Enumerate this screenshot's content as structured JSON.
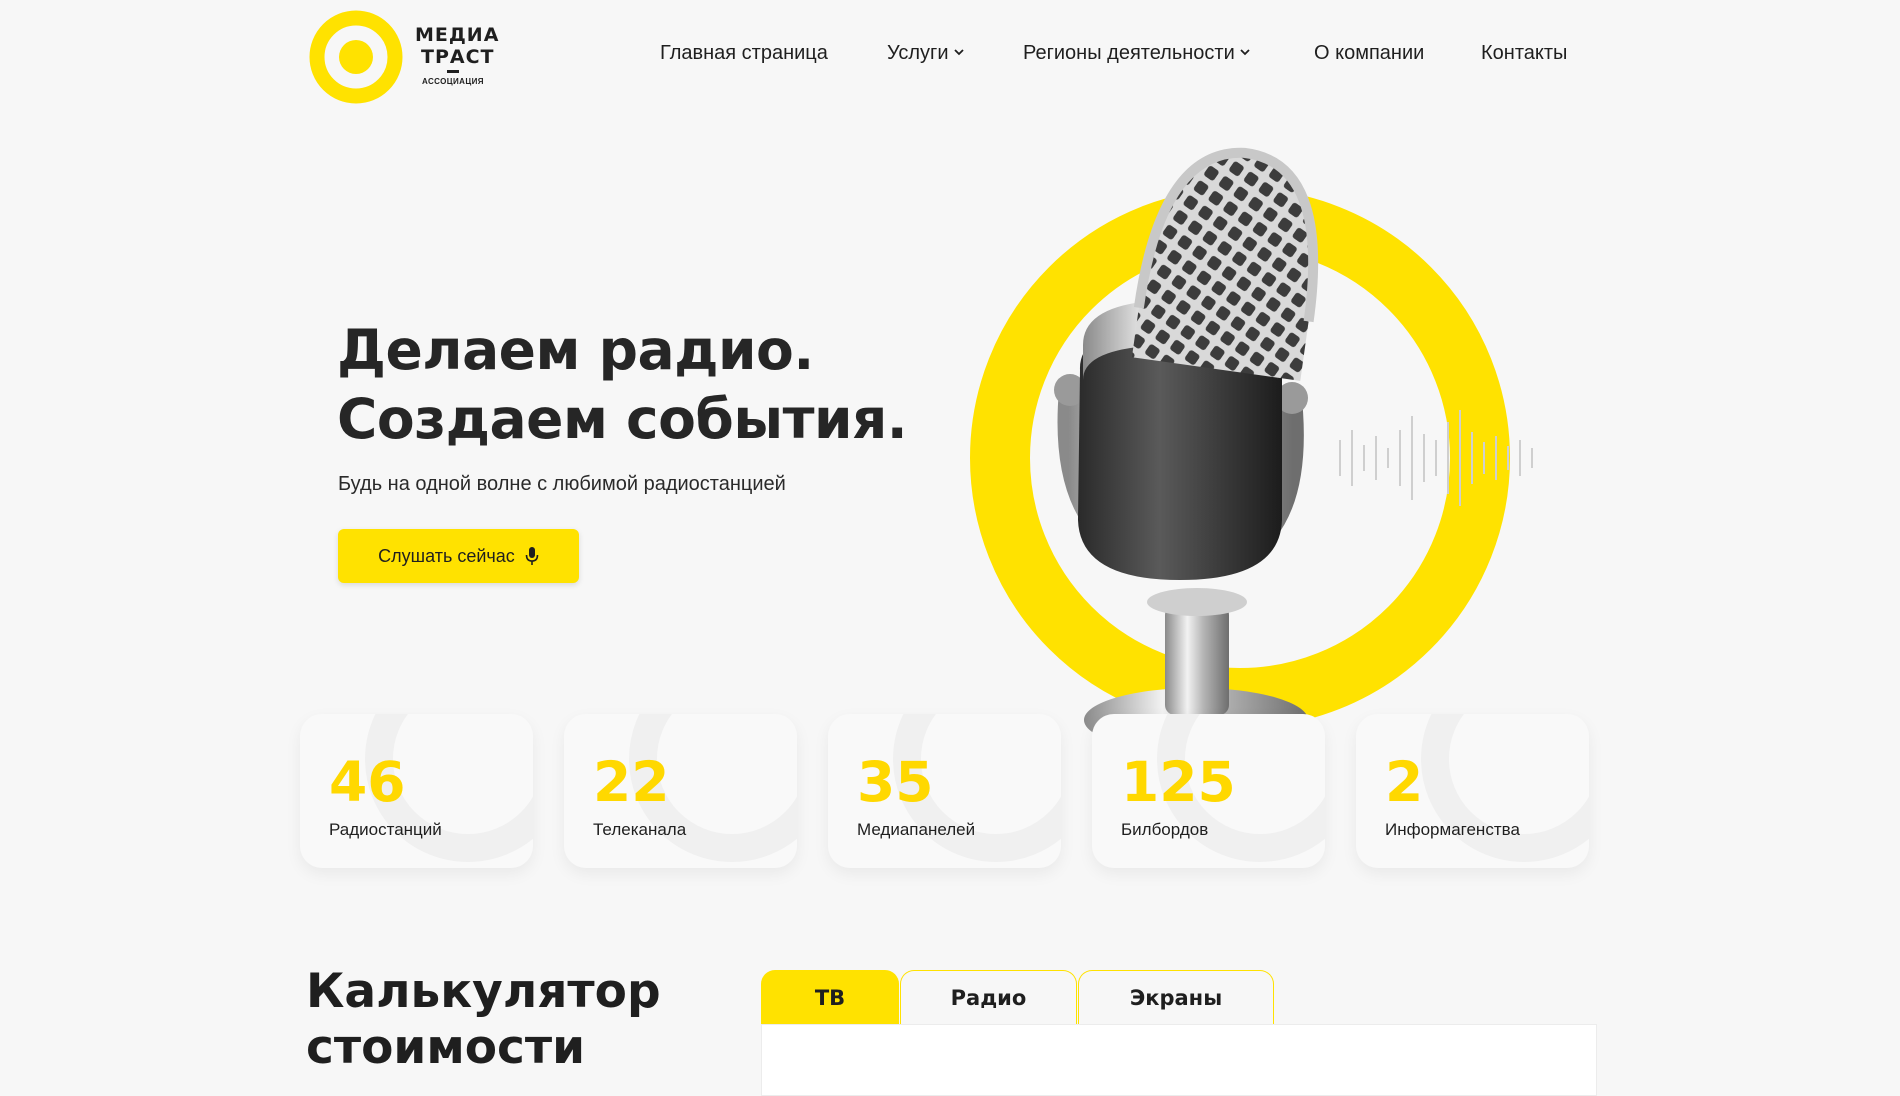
{
  "brand": {
    "logo_line1": "МЕДИА",
    "logo_line2": "ТРАСТ",
    "logo_sub": "АССОЦИАЦИЯ",
    "accent_color": "#ffe200",
    "logo_icon": "yellow-ring-icon"
  },
  "nav": {
    "items": [
      {
        "label": "Главная страница",
        "dropdown": false
      },
      {
        "label": "Услуги",
        "dropdown": true
      },
      {
        "label": "Регионы деятельности",
        "dropdown": true
      },
      {
        "label": "О компании",
        "dropdown": false
      },
      {
        "label": "Контакты",
        "dropdown": false
      }
    ]
  },
  "hero": {
    "title_line1": "Делаем радио.",
    "title_line2": "Создаем события.",
    "subtitle": "Будь на одной волне с любимой радиостанцией",
    "button_label": "Слушать сейчас",
    "button_icon": "microphone-icon",
    "illustration": "studio-microphone-on-yellow-ring"
  },
  "stats": [
    {
      "value": "46",
      "label": "Радиостанций"
    },
    {
      "value": "22",
      "label": "Телеканала"
    },
    {
      "value": "35",
      "label": "Медиапанелей"
    },
    {
      "value": "125",
      "label": "Билбордов"
    },
    {
      "value": "2",
      "label": "Информагенства"
    }
  ],
  "calculator": {
    "title_line1": "Калькулятор",
    "title_line2": "стоимости",
    "tabs": [
      {
        "label": "ТВ",
        "active": true
      },
      {
        "label": "Радио",
        "active": false
      },
      {
        "label": "Экраны",
        "active": false
      }
    ]
  }
}
